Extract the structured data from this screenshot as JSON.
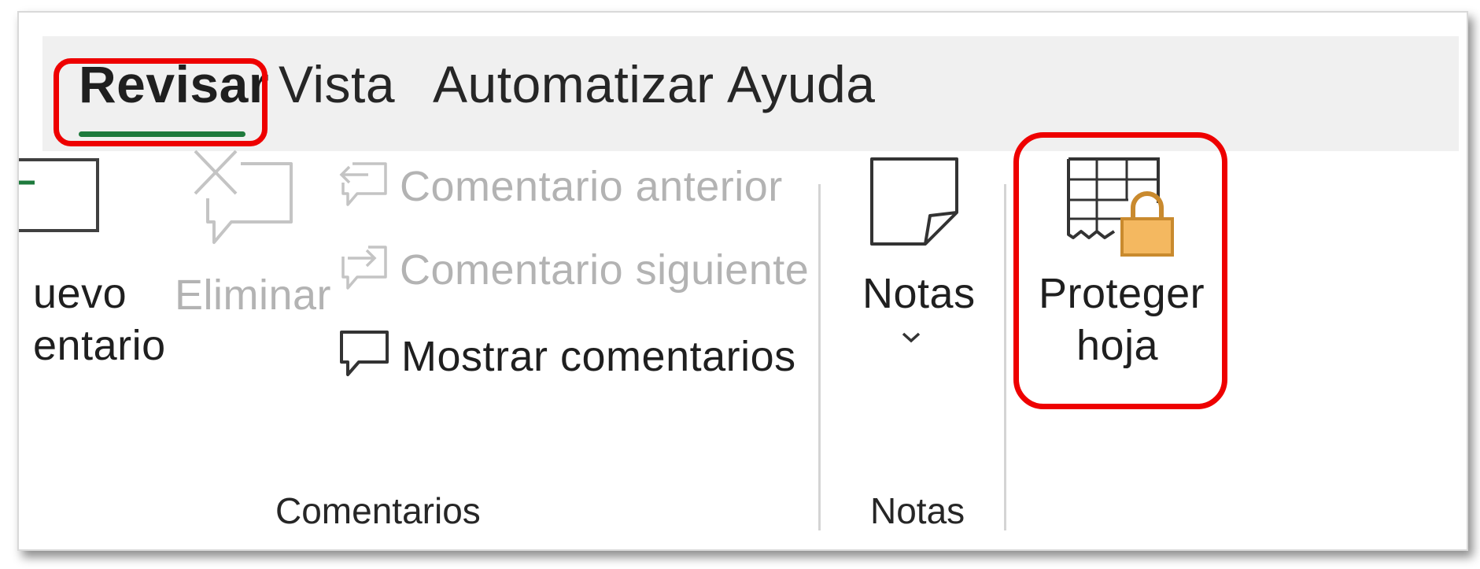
{
  "tabs": [
    {
      "label": "Revisar",
      "active": true
    },
    {
      "label": "Vista",
      "active": false
    },
    {
      "label": "Automatizar",
      "active": false
    },
    {
      "label": "Ayuda",
      "active": false
    }
  ],
  "comentarios_group": {
    "nuevo_comentario_line1": "uevo",
    "nuevo_comentario_line2": "entario",
    "eliminar_label": "Eliminar",
    "comentario_anterior_label": "Comentario anterior",
    "comentario_siguiente_label": "Comentario siguiente",
    "mostrar_comentarios_label": "Mostrar comentarios",
    "group_label": "Comentarios"
  },
  "notas_group": {
    "notas_button_label": "Notas",
    "group_label": "Notas"
  },
  "proteger_group": {
    "proteger_line1": "Proteger",
    "proteger_line2": "hoja"
  },
  "colors": {
    "highlight": "#ee0000",
    "active_tab_underline": "#1e7a3c",
    "lock_fill": "#f4b860",
    "lock_stroke": "#c98a2e",
    "disabled_text": "#b3b3b3"
  }
}
